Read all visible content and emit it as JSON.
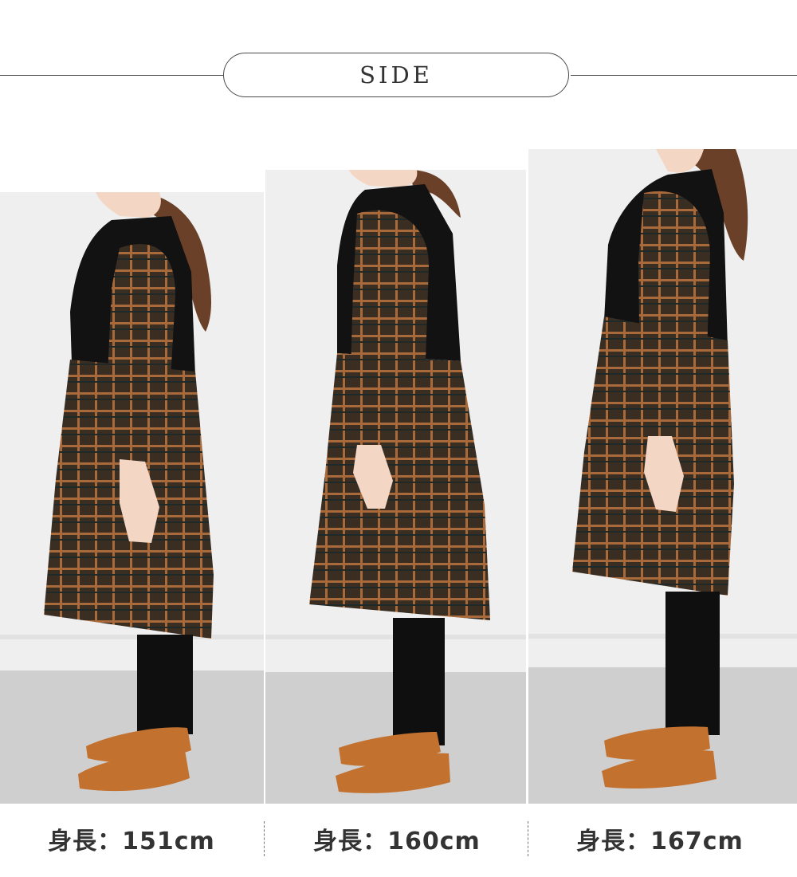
{
  "header": {
    "title": "SIDE"
  },
  "photos": [
    {
      "caption": "身長：151cm"
    },
    {
      "caption": "身長：160cm"
    },
    {
      "caption": "身長：167cm"
    }
  ],
  "colors": {
    "wall": "#efefef",
    "floor": "#cfcfcf",
    "plaid_base": "#3a2d22",
    "plaid_line": "#a86a3a",
    "knit": "#121212",
    "leggings": "#0f0f0f",
    "shoes": "#c2712f",
    "hair": "#6a4028",
    "skin": "#f3d6c3"
  }
}
